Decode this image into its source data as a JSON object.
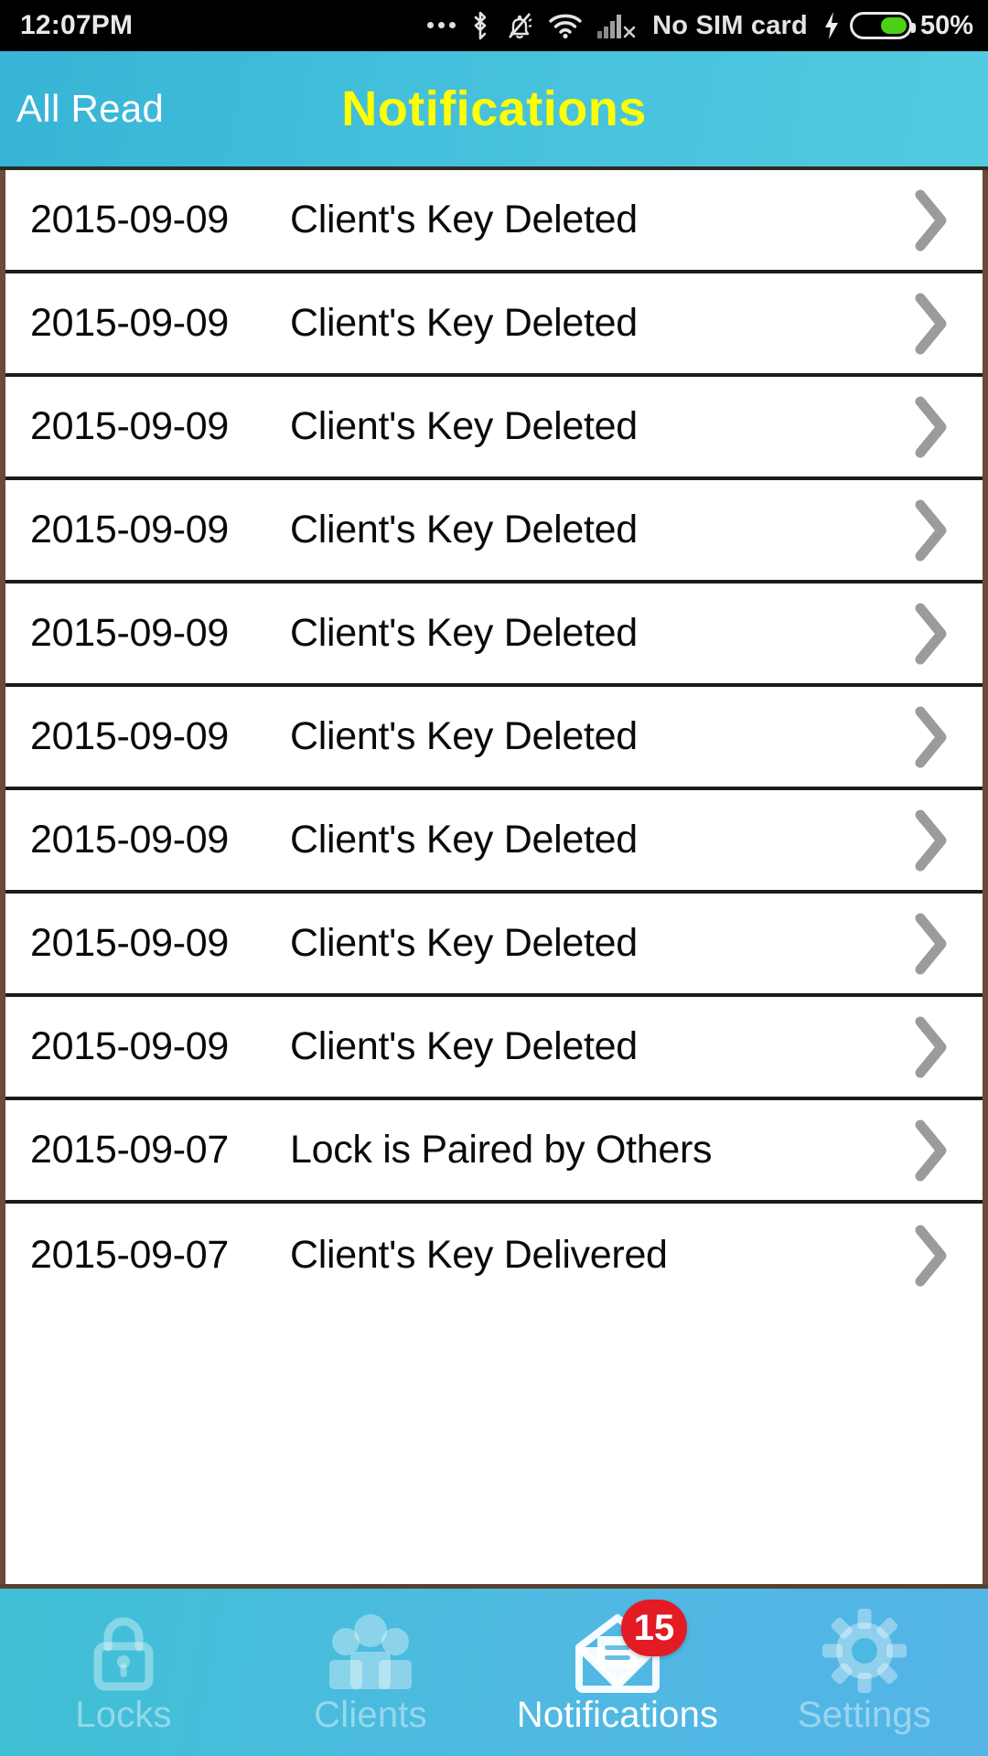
{
  "statusbar": {
    "time": "12:07PM",
    "carrier": "No SIM card",
    "battery_percent": "50%",
    "icons": [
      "more-dots-icon",
      "bluetooth-icon",
      "mute-bell-icon",
      "wifi-icon",
      "signal-no-service-icon",
      "charging-bolt-icon",
      "battery-icon"
    ]
  },
  "header": {
    "all_read_label": "All Read",
    "title": "Notifications",
    "title_color": "#ffff00",
    "background_start": "#37b4d6",
    "background_end": "#52cbe0"
  },
  "list": {
    "rows": [
      {
        "date": "2015-09-09",
        "message": "Client's Key Deleted"
      },
      {
        "date": "2015-09-09",
        "message": "Client's Key Deleted"
      },
      {
        "date": "2015-09-09",
        "message": "Client's Key Deleted"
      },
      {
        "date": "2015-09-09",
        "message": "Client's Key Deleted"
      },
      {
        "date": "2015-09-09",
        "message": "Client's Key Deleted"
      },
      {
        "date": "2015-09-09",
        "message": "Client's Key Deleted"
      },
      {
        "date": "2015-09-09",
        "message": "Client's Key Deleted"
      },
      {
        "date": "2015-09-09",
        "message": "Client's Key Deleted"
      },
      {
        "date": "2015-09-09",
        "message": "Client's Key Deleted"
      },
      {
        "date": "2015-09-07",
        "message": "Lock is Paired by Others"
      },
      {
        "date": "2015-09-07",
        "message": "Client's Key Delivered"
      }
    ],
    "chevron_color": "#9b9b9b"
  },
  "tabbar": {
    "items": [
      {
        "label": "Locks",
        "icon": "lock-icon",
        "active": false
      },
      {
        "label": "Clients",
        "icon": "people-icon",
        "active": false
      },
      {
        "label": "Notifications",
        "icon": "envelope-icon",
        "active": true,
        "badge": "15"
      },
      {
        "label": "Settings",
        "icon": "gear-icon",
        "active": false
      }
    ],
    "badge_color": "#e21b24"
  }
}
